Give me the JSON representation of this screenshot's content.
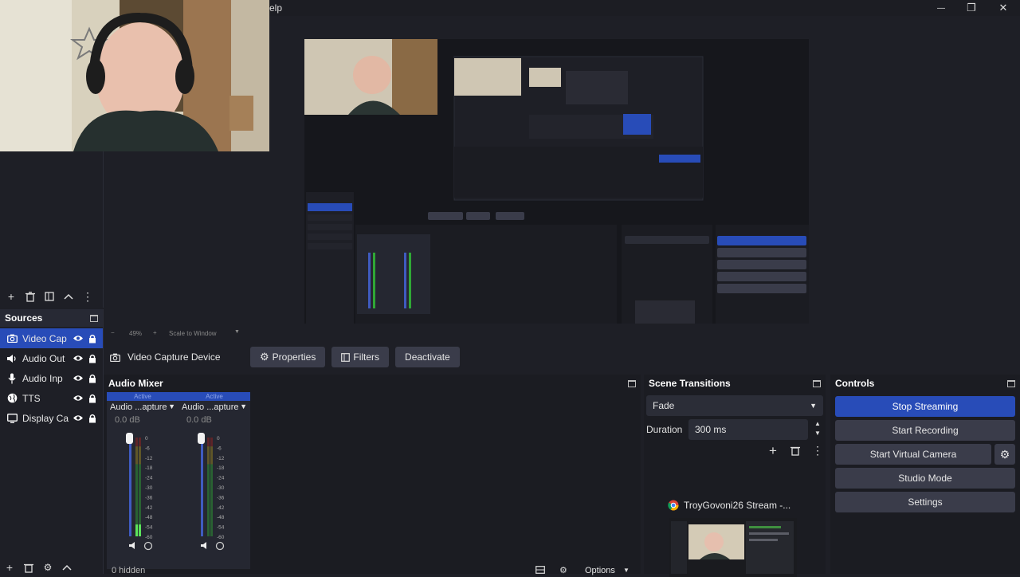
{
  "menu": {
    "help_fragment": "elp"
  },
  "window_controls": {
    "minimize": "—",
    "maximize": "❐",
    "close": "✕"
  },
  "zoom_bar": {
    "minus": "−",
    "zoom": "49%",
    "plus": "+",
    "scale_mode": "Scale to Window"
  },
  "sources": {
    "title": "Sources",
    "items": [
      {
        "label": "Video Cap",
        "icon": "camera-icon",
        "selected": true
      },
      {
        "label": "Audio Out",
        "icon": "speaker-icon",
        "selected": false
      },
      {
        "label": "Audio Inp",
        "icon": "microphone-icon",
        "selected": false
      },
      {
        "label": "TTS",
        "icon": "globe-icon",
        "selected": false
      },
      {
        "label": "Display Ca",
        "icon": "monitor-icon",
        "selected": false
      }
    ],
    "footer": {
      "hidden_count": "0 hidden"
    }
  },
  "context_bar": {
    "source_name": "Video Capture Device",
    "properties": "Properties",
    "filters": "Filters",
    "deactivate": "Deactivate"
  },
  "audio_mixer": {
    "title": "Audio Mixer",
    "channels": [
      {
        "status": "Active",
        "name": "Audio ...apture",
        "db": "0.0 dB",
        "level": 0.12
      },
      {
        "status": "Active",
        "name": "Audio ...apture",
        "db": "0.0 dB",
        "level": 0.0
      }
    ],
    "scale": [
      "0",
      "-6",
      "-12",
      "-18",
      "-24",
      "-30",
      "-36",
      "-42",
      "-48",
      "-54",
      "-60"
    ],
    "options": "Options"
  },
  "scene_transitions": {
    "title": "Scene Transitions",
    "transition": "Fade",
    "duration_label": "Duration",
    "duration_value": "300 ms",
    "stream_window_title": "TroyGovoni26 Stream -..."
  },
  "controls": {
    "title": "Controls",
    "stop_streaming": "Stop Streaming",
    "start_recording": "Start Recording",
    "start_virtual_camera": "Start Virtual Camera",
    "studio_mode": "Studio Mode",
    "settings": "Settings"
  },
  "colors": {
    "accent": "#284cb8",
    "panel": "#1b1c22",
    "button": "#3a3c4a",
    "meter_green": "#2fa836",
    "meter_yellow": "#a6911f",
    "meter_red": "#a3221f"
  }
}
